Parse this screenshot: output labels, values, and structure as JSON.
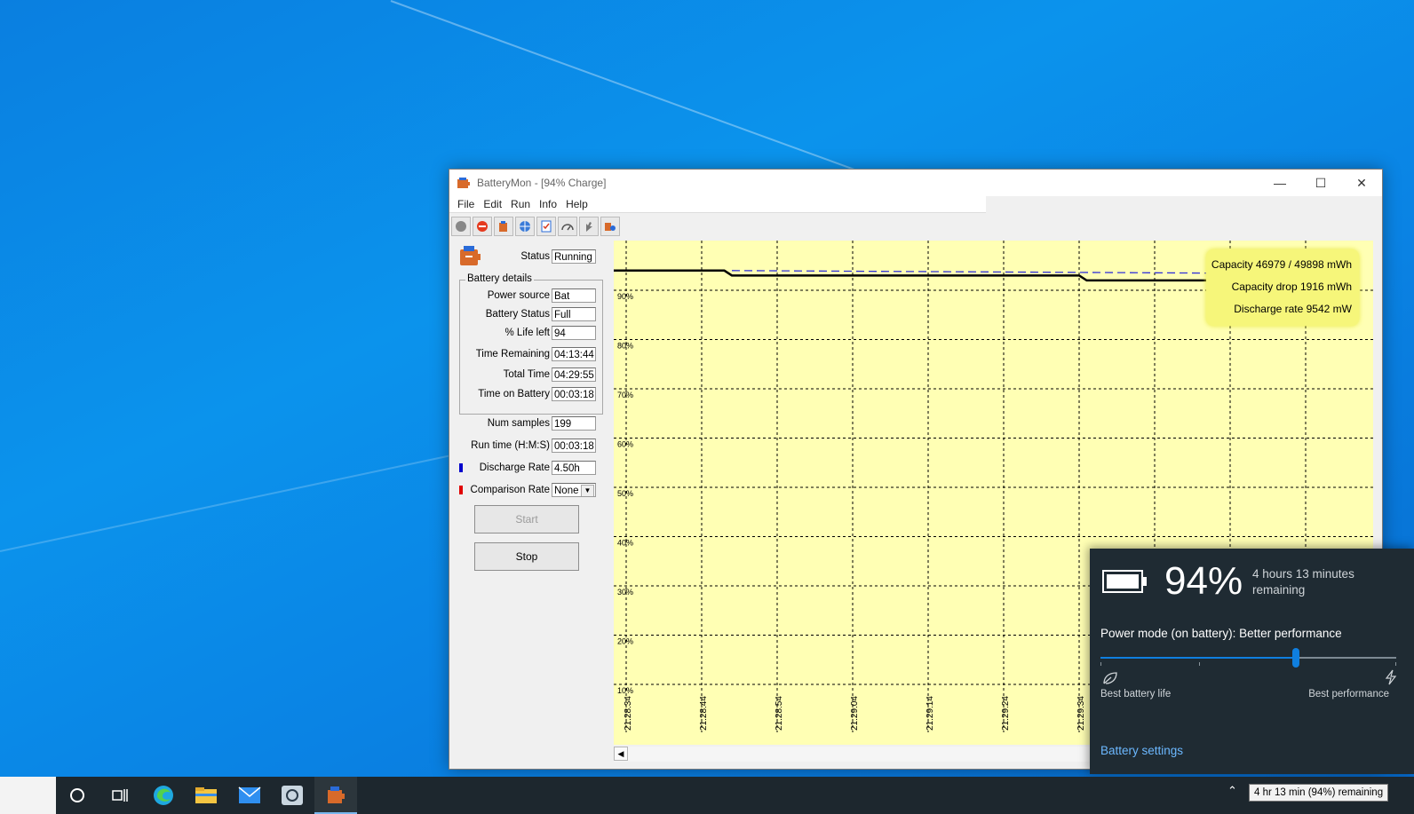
{
  "window": {
    "title": "BatteryMon - [94% Charge]",
    "menu": [
      "File",
      "Edit",
      "Run",
      "Info",
      "Help"
    ],
    "toolbar_icons": [
      "record-icon",
      "stop-icon",
      "battery-icon",
      "globe-icon",
      "checklist-icon",
      "gauge-icon",
      "pointer-icon",
      "settings-icon"
    ]
  },
  "status": {
    "label": "Status",
    "value": "Running"
  },
  "battery_details": {
    "legend": "Battery details",
    "power_source": {
      "label": "Power source",
      "value": "Bat"
    },
    "battery_status": {
      "label": "Battery Status",
      "value": "Full"
    },
    "life_left": {
      "label": "% Life left",
      "value": "94"
    },
    "time_remaining": {
      "label": "Time Remaining",
      "value": "04:13:44"
    },
    "total_time": {
      "label": "Total Time",
      "value": "04:29:55"
    },
    "time_on_battery": {
      "label": "Time on Battery",
      "value": "00:03:18"
    }
  },
  "num_samples": {
    "label": "Num samples",
    "value": "199"
  },
  "run_time": {
    "label": "Run time (H:M:S)",
    "value": "00:03:18"
  },
  "discharge_rate": {
    "label": "Discharge Rate",
    "value": "4.50h",
    "color": "#0000cc"
  },
  "comparison_rate": {
    "label": "Comparison Rate",
    "value": "None",
    "color": "#e00000"
  },
  "buttons": {
    "start": "Start",
    "stop": "Stop"
  },
  "chart_data": {
    "type": "line",
    "y_ticks": [
      "90%",
      "80%",
      "70%",
      "60%",
      "50%",
      "40%",
      "30%",
      "20%",
      "10%"
    ],
    "x_ticks": [
      "21:28:34",
      "21:28:44",
      "21:28:54",
      "21:29:04",
      "21:29:14",
      "21:29:24",
      "21:29:34"
    ],
    "ylim": [
      10,
      100
    ],
    "grid": true,
    "series": [
      {
        "style": "solid-black",
        "x": [
          "21:28:34",
          "21:28:47",
          "21:28:48",
          "21:29:34",
          "21:29:35",
          "21:29:62"
        ],
        "values": [
          94,
          94,
          93,
          93,
          92,
          92
        ]
      },
      {
        "style": "dashed-blue",
        "x": [
          "21:28:48",
          "21:29:62"
        ],
        "values": [
          94,
          93.4
        ]
      }
    ],
    "info_box": {
      "capacity": "Capacity 46979 / 49898 mWh",
      "capacity_drop": "Capacity drop 1916 mWh",
      "discharge_rate": "Discharge rate 9542 mW"
    }
  },
  "flyout": {
    "percent": "94%",
    "remaining_line1": "4 hours 13 minutes",
    "remaining_line2": "remaining",
    "mode": "Power mode (on battery): Better performance",
    "slider_level": 0.66,
    "best_battery": "Best battery life",
    "best_performance": "Best performance",
    "settings_link": "Battery settings"
  },
  "taskbar": {
    "tooltip": "4 hr 13 min (94%) remaining",
    "accent": "#79b8ee"
  }
}
